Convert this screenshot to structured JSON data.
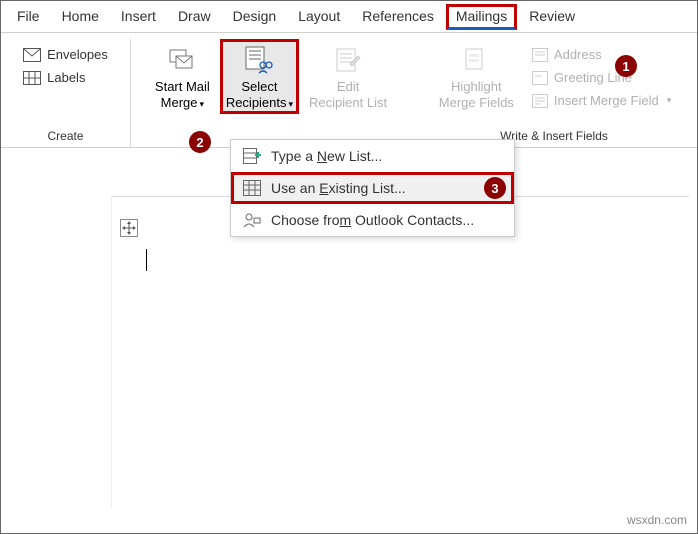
{
  "tabs": {
    "file": "File",
    "home": "Home",
    "insert": "Insert",
    "draw": "Draw",
    "design": "Design",
    "layout": "Layout",
    "references": "References",
    "mailings": "Mailings",
    "review": "Review"
  },
  "ribbon": {
    "create": {
      "label": "Create",
      "envelopes": "Envelopes",
      "labels": "Labels"
    },
    "start": {
      "start_mail_merge_l1": "Start Mail",
      "start_mail_merge_l2": "Merge",
      "select_recipients_l1": "Select",
      "select_recipients_l2": "Recipients",
      "edit_recipient_l1": "Edit",
      "edit_recipient_l2": "Recipient List"
    },
    "write": {
      "label": "Write & Insert Fields",
      "highlight_l1": "Highlight",
      "highlight_l2": "Merge Fields",
      "address_block": "Address",
      "greeting_line": "Greeting Line",
      "insert_merge_field": "Insert Merge Field"
    }
  },
  "dropdown": {
    "type_new": "Type a New List...",
    "use_existing": "Use an Existing List...",
    "outlook": "Choose from Outlook Contacts..."
  },
  "badges": {
    "b1": "1",
    "b2": "2",
    "b3": "3"
  },
  "watermark": "wsxdn.com"
}
